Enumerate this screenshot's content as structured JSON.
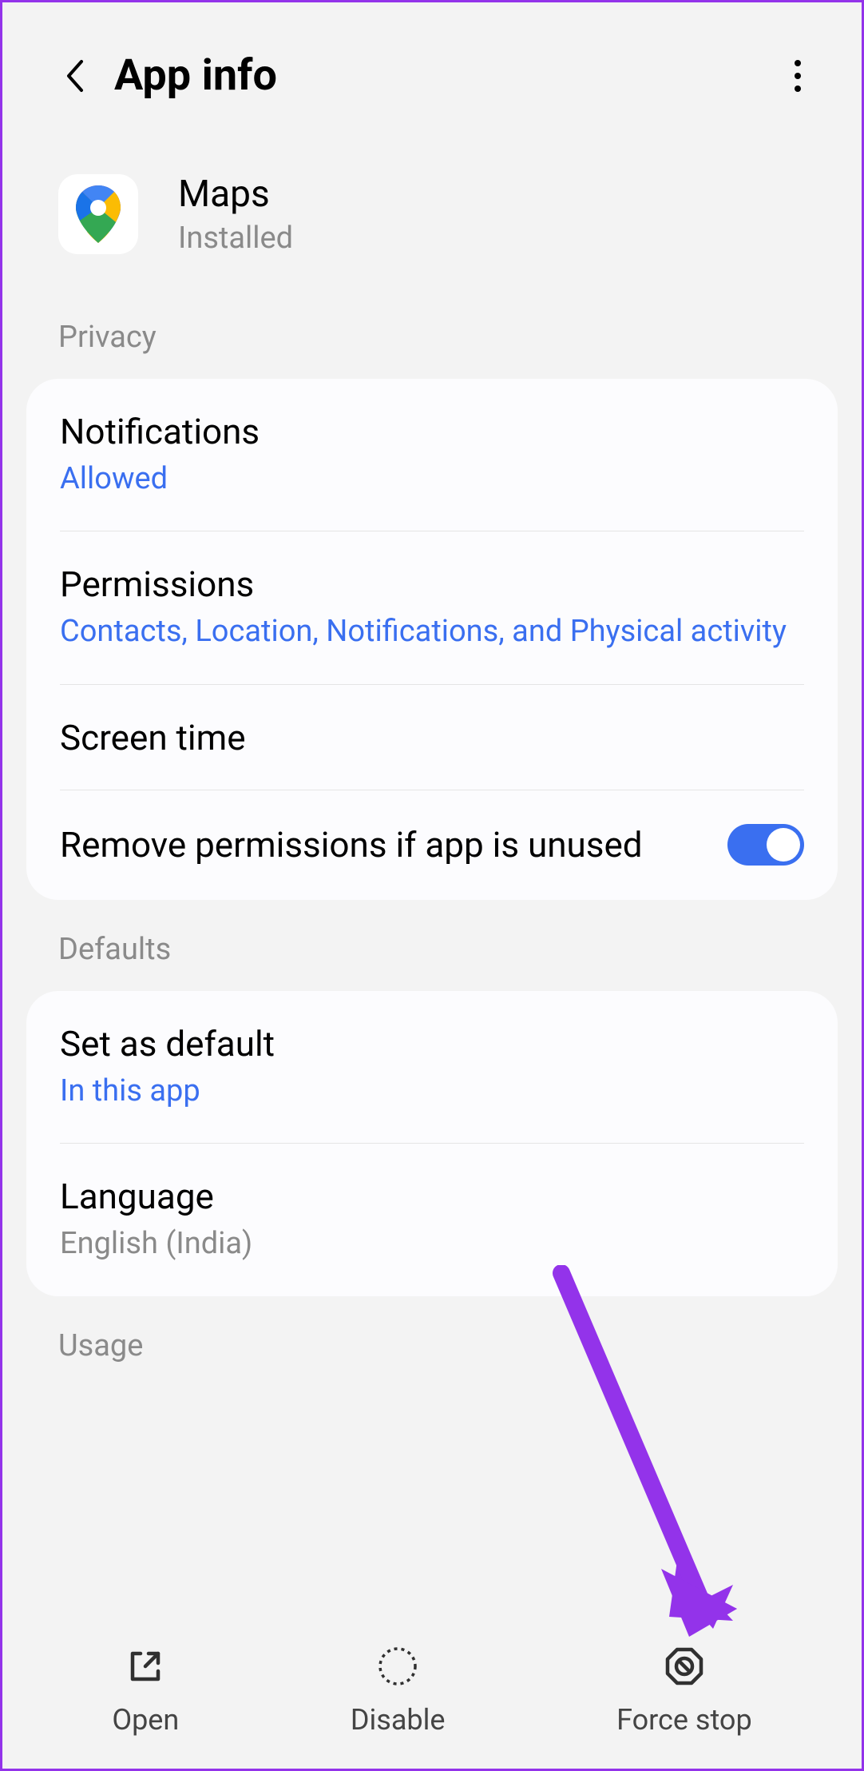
{
  "header": {
    "title": "App info"
  },
  "app": {
    "name": "Maps",
    "status": "Installed"
  },
  "sections": {
    "privacy": {
      "title": "Privacy",
      "items": {
        "notifications": {
          "title": "Notifications",
          "sub": "Allowed"
        },
        "permissions": {
          "title": "Permissions",
          "sub": "Contacts, Location, Notifications, and Physical activity"
        },
        "screentime": {
          "title": "Screen time"
        },
        "removeperms": {
          "title": "Remove permissions if app is unused"
        }
      }
    },
    "defaults": {
      "title": "Defaults",
      "items": {
        "setdefault": {
          "title": "Set as default",
          "sub": "In this app"
        },
        "language": {
          "title": "Language",
          "sub": "English (India)"
        }
      }
    },
    "usage": {
      "title": "Usage"
    }
  },
  "bottom": {
    "open": "Open",
    "disable": "Disable",
    "forcestop": "Force stop"
  }
}
